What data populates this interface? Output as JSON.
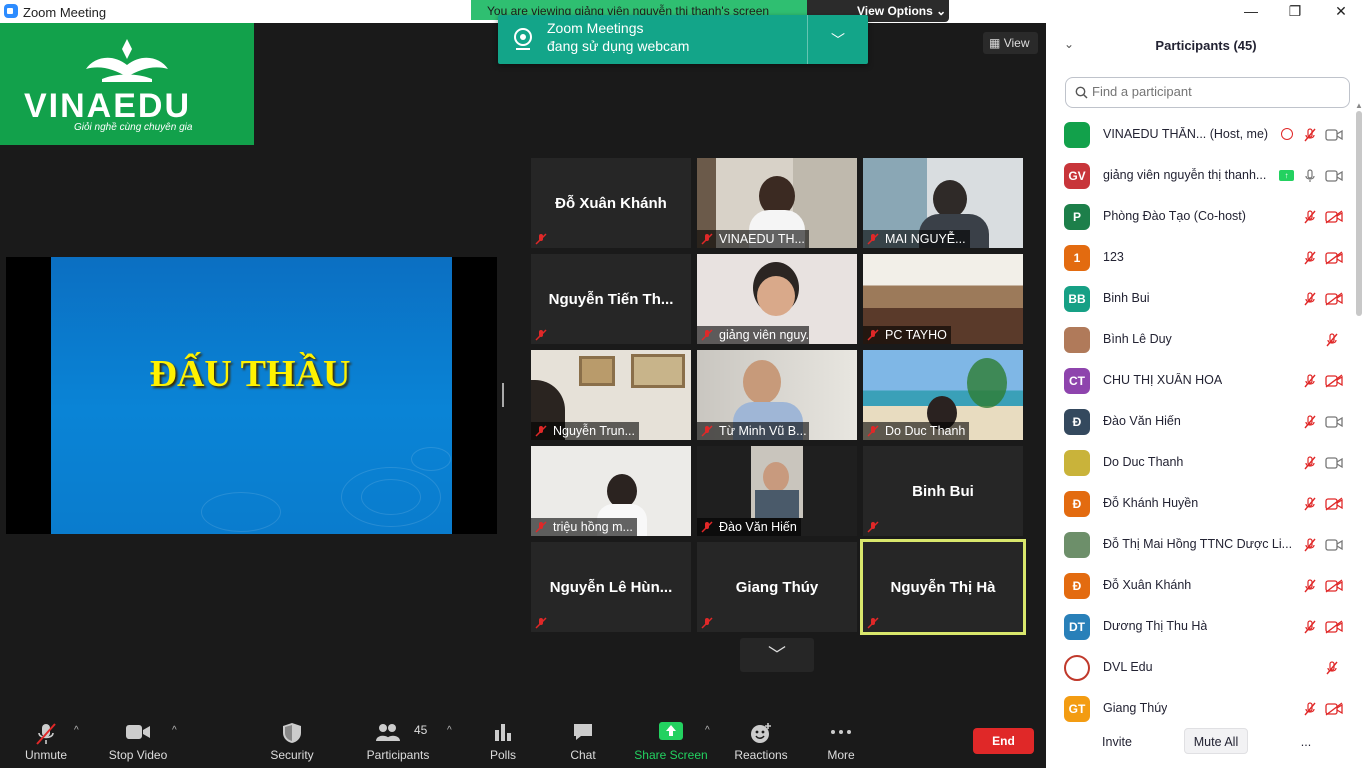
{
  "window": {
    "title": "Zoom Meeting"
  },
  "top_notice": {
    "text": "You are viewing giảng viên nguyễn thị thanh's screen",
    "view_options": "View Options"
  },
  "webcam_toast": {
    "line1": "Zoom Meetings",
    "line2": "đang sử dụng webcam"
  },
  "logo": {
    "brand": "VINAEDU",
    "tagline": "Giỏi nghề cùng chuyên gia"
  },
  "view_button": "View",
  "slide": {
    "title": "ĐẤU THẦU"
  },
  "tiles": [
    {
      "label": "Đỗ Xuân Khánh",
      "video": false
    },
    {
      "label": "VINAEDU TH...",
      "video": true
    },
    {
      "label": "MAI NGUYỄ...",
      "video": true
    },
    {
      "label": "Nguyễn Tiến Th...",
      "video": false
    },
    {
      "label": "giảng viên nguy...",
      "video": true
    },
    {
      "label": "PC TAYHO",
      "video": true
    },
    {
      "label": "Nguyễn Trun...",
      "video": true
    },
    {
      "label": "Từ Minh Vũ B...",
      "video": true
    },
    {
      "label": "Do Duc Thanh",
      "video": true
    },
    {
      "label": "triệu hồng m...",
      "video": true
    },
    {
      "label": "Đào Văn Hiến",
      "video": true
    },
    {
      "label": "Binh Bui",
      "video": false
    },
    {
      "label": "Nguyễn Lê Hùn...",
      "video": false
    },
    {
      "label": "Giang Thúy",
      "video": false
    },
    {
      "label": "Nguyễn Thị Hà",
      "video": false
    }
  ],
  "toolbar": {
    "unmute": "Unmute",
    "stop_video": "Stop Video",
    "security": "Security",
    "participants": "Participants",
    "participants_count": "45",
    "polls": "Polls",
    "chat": "Chat",
    "share_screen": "Share Screen",
    "reactions": "Reactions",
    "more": "More",
    "end": "End"
  },
  "panel": {
    "title": "Participants (45)",
    "search_placeholder": "Find a participant",
    "participants": [
      {
        "initials": "",
        "name": "VINAEDU THĂN...  (Host, me)",
        "color": "#12a14b",
        "mic": "muted",
        "cam": "on",
        "extra": "record"
      },
      {
        "initials": "GV",
        "name": "giảng viên nguyễn thị thanh...",
        "color": "#c8353a",
        "mic": "on",
        "cam": "on",
        "extra": "share"
      },
      {
        "initials": "P",
        "name": "Phòng Đào Tạo (Co-host)",
        "color": "#1d7f4a",
        "mic": "muted",
        "cam": "off"
      },
      {
        "initials": "1",
        "name": "123",
        "color": "#e36b10",
        "mic": "muted",
        "cam": "off"
      },
      {
        "initials": "BB",
        "name": "Binh Bui",
        "color": "#16a085",
        "mic": "muted",
        "cam": "off"
      },
      {
        "initials": "",
        "name": "Bình Lê Duy",
        "color": "#b07a5a",
        "mic": "muted",
        "cam": "none"
      },
      {
        "initials": "CT",
        "name": "CHU THỊ XUÂN HOA",
        "color": "#8e44ad",
        "mic": "muted",
        "cam": "off"
      },
      {
        "initials": "Đ",
        "name": "Đào Văn Hiến",
        "color": "#34495e",
        "mic": "muted",
        "cam": "on"
      },
      {
        "initials": "",
        "name": "Do Duc Thanh",
        "color": "#c9b33a",
        "mic": "muted",
        "cam": "on"
      },
      {
        "initials": "Đ",
        "name": "Đỗ Khánh Huyền",
        "color": "#e36b10",
        "mic": "muted",
        "cam": "off"
      },
      {
        "initials": "",
        "name": "Đỗ Thị Mai Hồng TTNC Dược Li...",
        "color": "#6d8f6a",
        "mic": "muted",
        "cam": "on"
      },
      {
        "initials": "Đ",
        "name": "Đỗ Xuân Khánh",
        "color": "#e36b10",
        "mic": "muted",
        "cam": "off"
      },
      {
        "initials": "DT",
        "name": "Dương Thị Thu Hà",
        "color": "#2980b9",
        "mic": "muted",
        "cam": "off"
      },
      {
        "initials": "",
        "name": "DVL Edu",
        "color": "#ffffff",
        "mic": "muted",
        "cam": "none"
      },
      {
        "initials": "GT",
        "name": "Giang Thúy",
        "color": "#f39c12",
        "mic": "muted",
        "cam": "off"
      }
    ],
    "invite": "Invite",
    "mute_all": "Mute All",
    "more": "..."
  }
}
